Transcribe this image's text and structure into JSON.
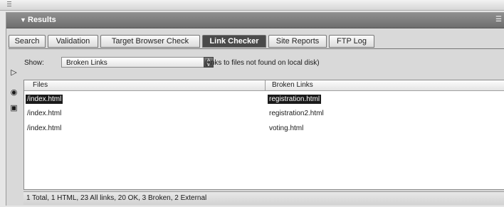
{
  "panel": {
    "title": "Results",
    "collapse_icon": "triangle-down-icon"
  },
  "tabs": [
    {
      "label": "Search"
    },
    {
      "label": "Validation"
    },
    {
      "label": "Target Browser Check"
    },
    {
      "label": "Link Checker",
      "active": true
    },
    {
      "label": "Site Reports"
    },
    {
      "label": "FTP Log"
    }
  ],
  "show": {
    "label": "Show:",
    "selected": "Broken Links",
    "description": "(links to files not found on local disk)"
  },
  "side_icons": [
    "play-icon",
    "info-icon",
    "save-icon"
  ],
  "table": {
    "columns": [
      "Files",
      "Broken Links"
    ],
    "rows": [
      {
        "file": "/index.html",
        "link": "registration.html",
        "selected": true
      },
      {
        "file": "/index.html",
        "link": "registration2.html"
      },
      {
        "file": "/index.html",
        "link": "voting.html"
      }
    ]
  },
  "status": {
    "text": "1 Total, 1 HTML, 23 All links, 20 OK, 3 Broken, 2 External"
  },
  "colors": {
    "selection": "#1a1a1a",
    "titlebar": "#7a7a7a"
  }
}
